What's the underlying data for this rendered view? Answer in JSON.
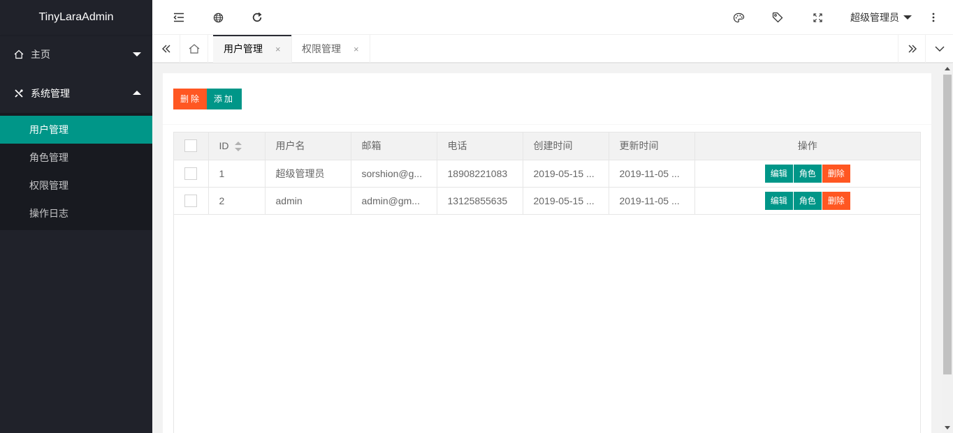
{
  "app": {
    "title": "TinyLaraAdmin"
  },
  "sidebar": {
    "items": [
      {
        "label": "主页",
        "icon": "home-icon",
        "expanded": false
      },
      {
        "label": "系统管理",
        "icon": "tools-icon",
        "expanded": true,
        "children": [
          {
            "label": "用户管理",
            "active": true
          },
          {
            "label": "角色管理"
          },
          {
            "label": "权限管理"
          },
          {
            "label": "操作日志"
          }
        ]
      }
    ]
  },
  "header": {
    "icons": [
      "menu-shrink-icon",
      "globe-icon",
      "refresh-icon",
      "palette-icon",
      "tag-icon",
      "fullscreen-icon",
      "more-vertical-icon"
    ],
    "user_name": "超级管理员"
  },
  "tabs": {
    "items": [
      {
        "label": "用户管理",
        "active": true,
        "close": "×"
      },
      {
        "label": "权限管理",
        "active": false,
        "close": "×"
      }
    ]
  },
  "toolbar": {
    "delete_label": "删除",
    "add_label": "添加"
  },
  "table": {
    "columns": [
      "ID",
      "用户名",
      "邮箱",
      "电话",
      "创建时间",
      "更新时间",
      "操作"
    ],
    "rows": [
      {
        "id": "1",
        "username": "超级管理员",
        "email": "sorshion@g...",
        "phone": "18908221083",
        "created": "2019-05-15 ...",
        "updated": "2019-11-05 ..."
      },
      {
        "id": "2",
        "username": "admin",
        "email": "admin@gm...",
        "phone": "13125855635",
        "created": "2019-05-15 ...",
        "updated": "2019-11-05 ..."
      }
    ],
    "row_actions": {
      "edit": "编辑",
      "role": "角色",
      "delete": "删除"
    }
  },
  "colors": {
    "accent": "#009688",
    "danger": "#ff5722",
    "sidebar_bg": "#20222a"
  }
}
